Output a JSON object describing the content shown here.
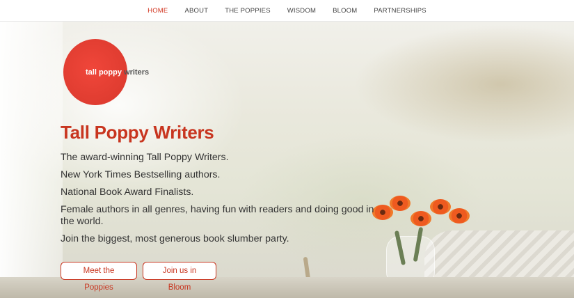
{
  "nav": {
    "items": [
      {
        "label": "HOME",
        "active": true
      },
      {
        "label": "ABOUT",
        "active": false
      },
      {
        "label": "THE POPPIES",
        "active": false
      },
      {
        "label": "WISDOM",
        "active": false
      },
      {
        "label": "BLOOM",
        "active": false
      },
      {
        "label": "PARTNERSHIPS",
        "active": false
      }
    ]
  },
  "logo": {
    "text_primary": "tall poppy",
    "text_secondary": "writers"
  },
  "hero": {
    "title": "Tall Poppy Writers",
    "lines": [
      "The award-winning Tall Poppy Writers.",
      "New York Times Bestselling authors.",
      "National Book Award Finalists.",
      "Female authors in all genres, having fun with readers and doing good in the world.",
      "Join the biggest, most generous book slumber party."
    ],
    "buttons": {
      "meet": "Meet the Poppies",
      "bloom": "Join us in Bloom"
    }
  },
  "colors": {
    "accent": "#c8351f",
    "logo_red": "#e8413a",
    "nav_active": "#d2341e",
    "text": "#333333"
  }
}
